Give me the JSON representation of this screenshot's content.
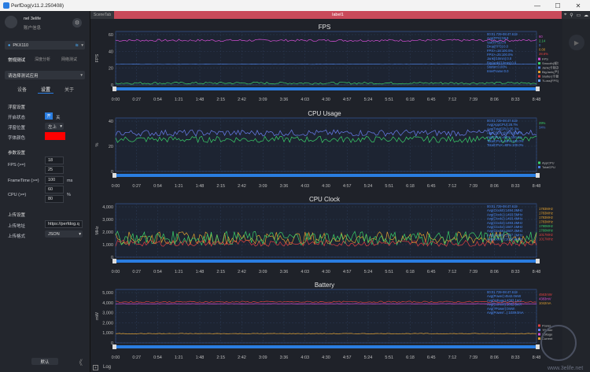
{
  "window": {
    "title": "PerfDog(v11.2.250408)",
    "min": "—",
    "max": "☐",
    "close": "✕"
  },
  "user": {
    "name": "nel 3elife",
    "sub": "账户信息"
  },
  "device": {
    "name": "PKX110"
  },
  "mode_tabs": [
    "常规测试",
    "深度分析",
    "网络测试"
  ],
  "app_select": {
    "placeholder": "请选择测试应用"
  },
  "sub_tabs": [
    "设备",
    "设置",
    "关于"
  ],
  "float": {
    "section": "浮窗设置",
    "state_label": "开启状态",
    "state_on": "开",
    "state_off": "关",
    "pos_label": "浮窗位置",
    "pos_value": "左上",
    "color_label": "字体颜色",
    "color_value": "#ff0000"
  },
  "params": {
    "section": "参数设置",
    "fps_label": "FPS (>=)",
    "fps_values": [
      "18",
      "25"
    ],
    "ft_label": "FrameTime (>=)",
    "ft_value": "100",
    "ft_unit": "ms",
    "cpu_label": "CPU (>=)",
    "cpu_values": [
      "60",
      "80"
    ],
    "cpu_unit": "%"
  },
  "upload": {
    "section": "上传设置",
    "addr_label": "上传地址",
    "addr_value": "https://perfdog.q",
    "fmt_label": "上传格式",
    "fmt_value": "JSON"
  },
  "default_button": "默认",
  "collapse": "《",
  "tabs": {
    "scene": "SceneTab",
    "label": "label1"
  },
  "log_label": "Log",
  "x_ticks": [
    "0:00",
    "0:27",
    "0:54",
    "1:21",
    "1:48",
    "2:15",
    "2:42",
    "3:09",
    "3:36",
    "4:03",
    "4:30",
    "4:57",
    "5:24",
    "5:51",
    "6:18",
    "6:45",
    "7:12",
    "7:39",
    "8:06",
    "8:33",
    "8:48"
  ],
  "watermark": {
    "text": "www.3elife.net"
  },
  "chart_data": [
    {
      "type": "line",
      "title": "FPS",
      "ylabel": "FPS",
      "ylim": [
        0,
        72
      ],
      "yticks": [
        "60",
        "40",
        "20",
        "0"
      ],
      "legend": [
        "FPS",
        "Smooth(帧均衡)",
        "Jank(卡顿次数)",
        "BigJank(严重卡顿)",
        "Stutter(卡顿率)",
        "?Loss(FPS)"
      ],
      "legend_colors": [
        "#d64fd6",
        "#3ad16a",
        "#4c7fe0",
        "#e0a030",
        "#e04040",
        "#6aa0ff"
      ],
      "summary": [
        "00:01.729-08:47.619",
        "Avg(FPS):59.9",
        "Var(FPS):0.4",
        "Drop(FPS):0.0",
        "FPS>=18:100.0%",
        "FPS>=25:100.0%",
        "Jank(/10min):0.0",
        "BigJank(/10min):0.0",
        "Stutter:0.00%",
        "InterFrame:0.0"
      ],
      "right_values": [
        "60",
        "2.14",
        "0",
        "0.00",
        "28.6%"
      ],
      "right_colors": [
        "#d64fd6",
        "#3ad16a",
        "#4c7fe0",
        "#e0a030",
        "#e04040"
      ],
      "series": [
        {
          "name": "FPS",
          "color": "#d64fd6",
          "base": 60,
          "noise": 1.5
        },
        {
          "name": "Smooth(帧均衡)",
          "color": "#3ad16a",
          "base": 2.5,
          "noise": 1.5
        },
        {
          "name": "?Loss(FPS)",
          "color": "#4c7fe0",
          "base": 28,
          "noise": 0.3
        }
      ]
    },
    {
      "type": "line",
      "title": "CPU Usage",
      "ylabel": "%",
      "ylim": [
        0,
        50
      ],
      "yticks": [
        "40",
        "20",
        "0"
      ],
      "legend": [
        "AppCPU",
        "TotalCPU"
      ],
      "legend_colors": [
        "#3ad16a",
        "#4c7fe0"
      ],
      "summary": [
        "00:01.729-08:47.619",
        "Avg(AppCPU):28.7%",
        "Avg(TotalCPU):35.3%",
        "AppCPU<=60%:100.0%",
        "AppCPU<=80%:100.0%",
        "TotalCPU<=60%:100.0%",
        "TotalCPU<=80%:100.0%"
      ],
      "right_values": [
        "29%",
        "34%"
      ],
      "right_colors": [
        "#3ad16a",
        "#4c7fe0"
      ],
      "series": [
        {
          "name": "AppCPU",
          "color": "#3ad16a",
          "base": 30,
          "noise": 3
        },
        {
          "name": "TotalCPU",
          "color": "#6a7ff0",
          "base": 36,
          "noise": 3
        }
      ]
    },
    {
      "type": "line",
      "title": "CPU Clock",
      "ylabel": "MHz",
      "ylim": [
        0,
        4200
      ],
      "yticks": [
        "4,000",
        "3,000",
        "2,000",
        "1,000",
        "0"
      ],
      "summary": [
        "00:01.729-08:47.619",
        "Avg(Clock0):1494.2MHz",
        "Avg(Clock1):1493.5MHz",
        "Avg(Clock2):1493.4MHz",
        "Avg(Clock3):1493.2MHz",
        "Avg(Clock4):1507.1MHz",
        "Avg(Clock5):1507.3MHz",
        "Avg(Clock6):1507.2MHz",
        "Avg(Clock7):1083.4MHz"
      ],
      "right_values": [
        "1783MHz",
        "1783MHz",
        "1783MHz",
        "1783MHz",
        "1780MHz",
        "1780MHz",
        "1017MHz",
        "1017MHz"
      ],
      "right_colors": [
        "#e0a030",
        "#e0a030",
        "#e0a030",
        "#e0a030",
        "#3ad16a",
        "#3ad16a",
        "#e04040",
        "#e04040"
      ],
      "series": [
        {
          "name": "Clock0-3",
          "color": "#e0a030",
          "base": 1500,
          "noise": 500
        },
        {
          "name": "Clock4-6",
          "color": "#3ad16a",
          "base": 1500,
          "noise": 550
        },
        {
          "name": "Clock7",
          "color": "#e04040",
          "base": 1100,
          "noise": 250
        }
      ]
    },
    {
      "type": "line",
      "title": "Battery",
      "ylabel": "mW",
      "ylim": [
        0,
        6000
      ],
      "yticks": [
        "5,000",
        "4,000",
        "3,000",
        "2,000",
        "1,000",
        "0"
      ],
      "legend": [
        "Power",
        "?Power",
        "Voltage",
        "Current"
      ],
      "legend_colors": [
        "#e04040",
        "#6a7ff0",
        "#d64fd6",
        "#e0a030"
      ],
      "summary": [
        "00:01.729-08:47.619",
        "Avg(Power):4542.0mW",
        "Avg(Voltage):4393.1mV",
        "Avg(Current):1032.6mA",
        "Avg(?Power):0mW",
        "Avg(Power/...):1039.0mA"
      ],
      "right_values": [
        "4563mW",
        "4383mV",
        "1042mA"
      ],
      "right_colors": [
        "#e04040",
        "#d64fd6",
        "#e0a030"
      ],
      "series": [
        {
          "name": "Power",
          "color": "#e04040",
          "base": 4600,
          "noise": 80
        },
        {
          "name": "Voltage",
          "color": "#d64fd6",
          "base": 4380,
          "noise": 30
        },
        {
          "name": "Current",
          "color": "#e0a030",
          "base": 1040,
          "noise": 30
        }
      ]
    }
  ]
}
